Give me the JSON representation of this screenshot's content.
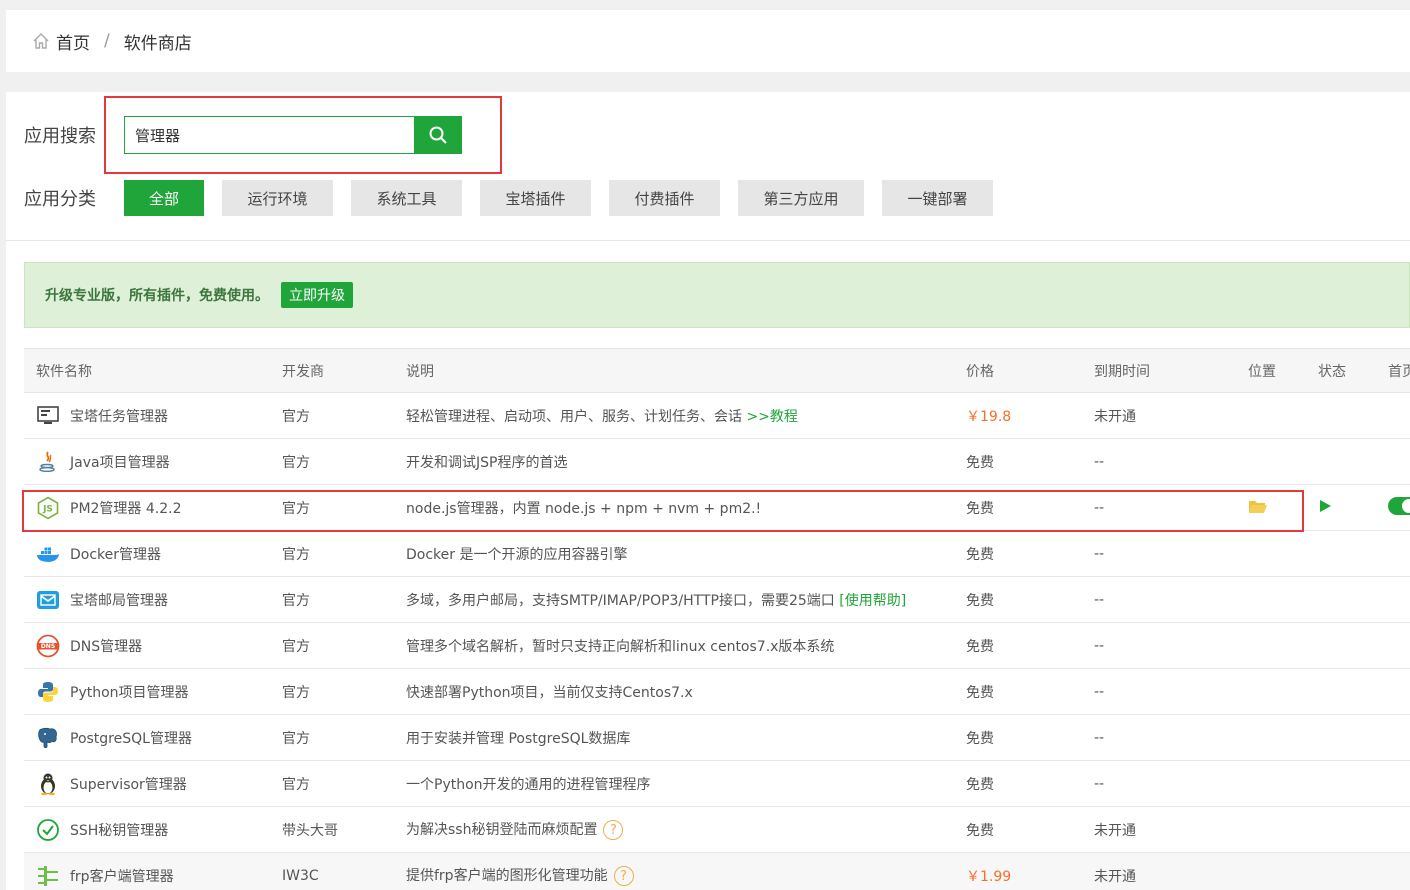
{
  "breadcrumb": {
    "home": "首页",
    "separator": "/",
    "current": "软件商店"
  },
  "search": {
    "label": "应用搜索",
    "value": "管理器"
  },
  "categories": {
    "label": "应用分类",
    "items": [
      "全部",
      "运行环境",
      "系统工具",
      "宝塔插件",
      "付费插件",
      "第三方应用",
      "一键部署"
    ],
    "active": "全部"
  },
  "upgrade": {
    "text": "升级专业版，所有插件，免费使用。",
    "button": "立即升级"
  },
  "table": {
    "headers": [
      "软件名称",
      "开发商",
      "说明",
      "价格",
      "到期时间",
      "位置",
      "状态",
      "首页"
    ],
    "rows": [
      {
        "icon": "monitor-icon",
        "name": "宝塔任务管理器",
        "dev": "官方",
        "desc": "轻松管理进程、启动项、用户、服务、计划任务、会话",
        "desc_link": ">>教程",
        "price": "￥19.8",
        "expire": "未开通"
      },
      {
        "icon": "java-icon",
        "name": "Java项目管理器",
        "dev": "官方",
        "desc": "开发和调试JSP程序的首选",
        "price": "免费",
        "expire": "--"
      },
      {
        "icon": "nodejs-icon",
        "name": "PM2管理器 4.2.2",
        "dev": "官方",
        "desc": "node.js管理器，内置 node.js + npm + nvm + pm2.!",
        "price": "免费",
        "expire": "--"
      },
      {
        "icon": "docker-icon",
        "name": "Docker管理器",
        "dev": "官方",
        "desc": "Docker 是一个开源的应用容器引擎",
        "price": "免费",
        "expire": "--"
      },
      {
        "icon": "mail-icon",
        "name": "宝塔邮局管理器",
        "dev": "官方",
        "desc": "多域，多用户邮局，支持SMTP/IMAP/POP3/HTTP接口，需要25端口",
        "desc_link": "[使用帮助]",
        "price": "免费",
        "expire": "--"
      },
      {
        "icon": "dns-icon",
        "name": "DNS管理器",
        "dev": "官方",
        "desc": "管理多个域名解析，暂时只支持正向解析和linux centos7.x版本系统",
        "price": "免费",
        "expire": "--"
      },
      {
        "icon": "python-icon",
        "name": "Python项目管理器",
        "dev": "官方",
        "desc": "快速部署Python项目，当前仅支持Centos7.x",
        "price": "免费",
        "expire": "--"
      },
      {
        "icon": "postgresql-icon",
        "name": "PostgreSQL管理器",
        "dev": "官方",
        "desc": "用于安装并管理 PostgreSQL数据库",
        "price": "免费",
        "expire": "--"
      },
      {
        "icon": "linux-penguin-icon",
        "name": "Supervisor管理器",
        "dev": "官方",
        "desc": "一个Python开发的通用的进程管理程序",
        "price": "免费",
        "expire": "--"
      },
      {
        "icon": "ssh-key-icon",
        "name": "SSH秘钥管理器",
        "dev": "带头大哥",
        "desc": "为解决ssh秘钥登陆而麻烦配置",
        "help": "?",
        "price": "免费",
        "expire": "未开通"
      },
      {
        "icon": "frp-icon",
        "name": "frp客户端管理器",
        "dev": "IW3C",
        "desc": "提供frp客户端的图形化管理功能",
        "help": "?",
        "price": "￥1.99",
        "expire": "未开通"
      }
    ]
  },
  "colors": {
    "accent": "#20a53a",
    "highlight_border": "#e3393c",
    "price": "#fc6d26"
  }
}
